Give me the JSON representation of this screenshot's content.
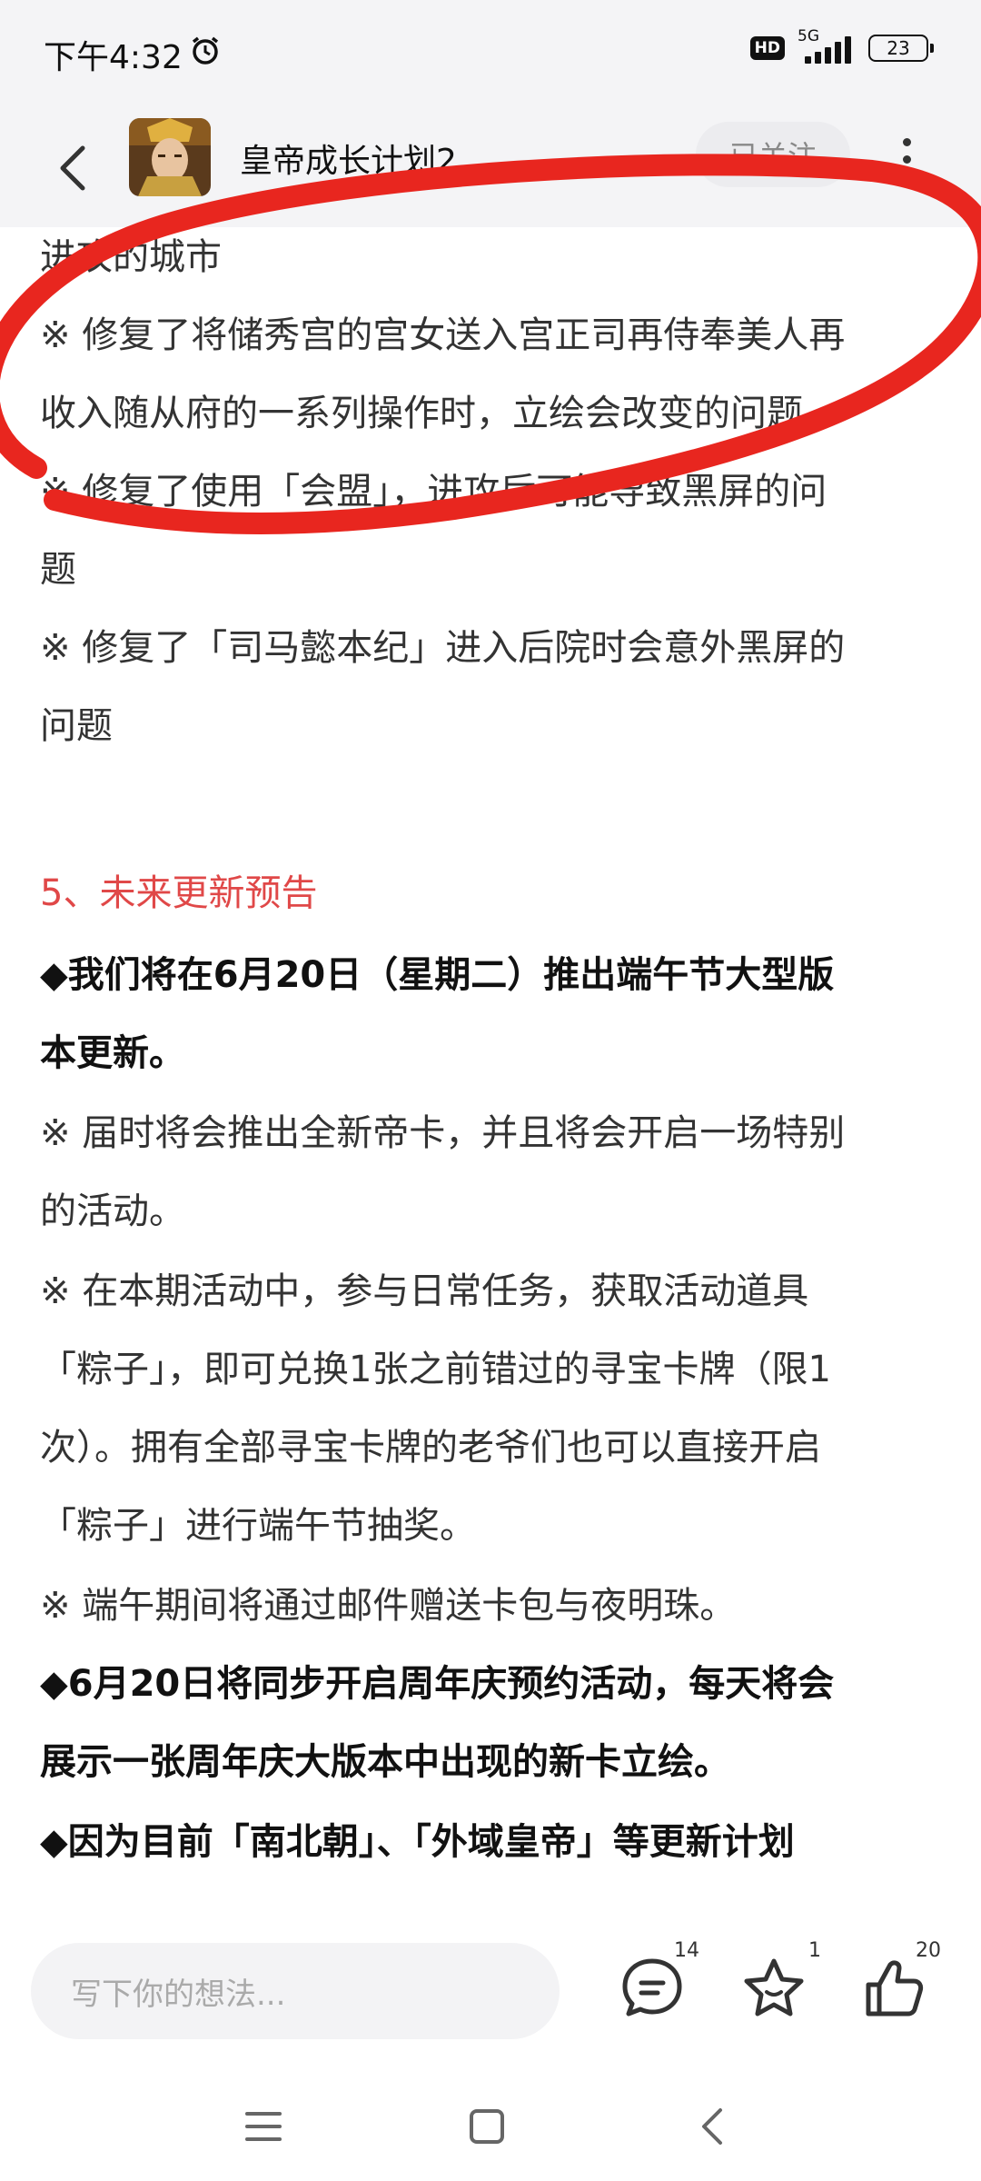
{
  "status_bar": {
    "time": "下午4:32",
    "hd": "HD",
    "network": "5G",
    "battery": "23"
  },
  "header": {
    "title": "皇帝成长计划2",
    "follow_label": "已关注"
  },
  "content": {
    "lines": [
      "进攻的城市",
      "※ 修复了将储秀宫的宫女送入宫正司再侍奉美人再",
      "收入随从府的一系列操作时，立绘会改变的问题",
      "※ 修复了使用「会盟」，进攻后可能导致黑屏的问",
      "题",
      "※ 修复了「司马懿本纪」进入后院时会意外黑屏的",
      "问题"
    ],
    "section_title": "5、未来更新预告",
    "bold1": [
      "◆我们将在6月20日（星期二）推出端午节大型版",
      "本更新。"
    ],
    "note1": [
      "※ 届时将会推出全新帝卡，并且将会开启一场特别",
      "的活动。"
    ],
    "note2": [
      "※ 在本期活动中，参与日常任务，获取活动道具",
      "「粽子」，即可兑换1张之前错过的寻宝卡牌（限1",
      "次）。拥有全部寻宝卡牌的老爷们也可以直接开启",
      "「粽子」进行端午节抽奖。"
    ],
    "note3": "※ 端午期间将通过邮件赠送卡包与夜明珠。",
    "bold2": [
      "◆6月20日将同步开启周年庆预约活动，每天将会",
      "展示一张周年庆大版本中出现的新卡立绘。"
    ],
    "bold3": "◆因为目前「南北朝」、「外域皇帝」等更新计划"
  },
  "bottom_bar": {
    "comment_placeholder": "写下你的想法...",
    "comment_count": "14",
    "favorite_count": "1",
    "like_count": "20"
  },
  "colors": {
    "section_title": "#e04848",
    "annotation": "#e8261f",
    "background": "#f4f4f6"
  }
}
